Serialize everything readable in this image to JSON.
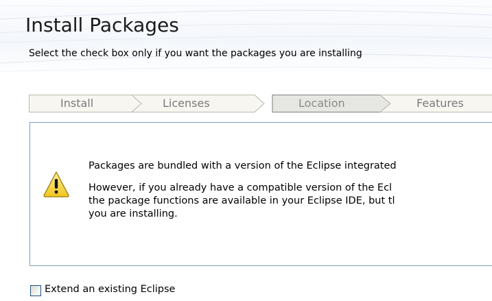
{
  "header": {
    "title": "Install Packages",
    "subtitle": "Select the check box only if you want the packages you are installing"
  },
  "steps": [
    {
      "label": "Install",
      "state": "done"
    },
    {
      "label": "Licenses",
      "state": "done"
    },
    {
      "label": "Location",
      "state": "current"
    },
    {
      "label": "Features",
      "state": "pending"
    }
  ],
  "info": {
    "icon": "warning-icon",
    "paragraph1": "Packages are bundled with a version of the Eclipse integrated",
    "paragraph2_lines": [
      "However, if you already have a compatible version of the Ecl",
      "the package functions are available in your Eclipse IDE, but tl",
      "you are installing."
    ]
  },
  "extend_checkbox": {
    "label": "Extend an existing Eclipse",
    "checked": false
  },
  "colors": {
    "box_border": "#7f9db9",
    "checkbox_border": "#1c5180",
    "warning_yellow": "#f7d339",
    "step_text": "#7a7a7a"
  }
}
